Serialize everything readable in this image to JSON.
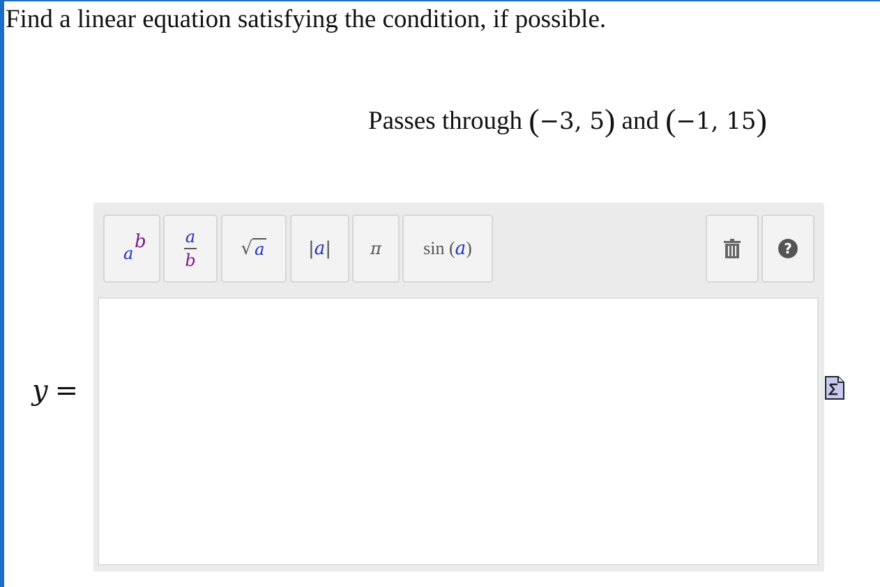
{
  "question": {
    "prompt": "Find a linear equation satisfying the condition, if possible.",
    "condition_text": "Passes through",
    "point1": {
      "x": "−3",
      "y": "5"
    },
    "connector": "and",
    "point2": {
      "x": "−1",
      "y": "15"
    }
  },
  "answer": {
    "variable": "y",
    "equals": "=",
    "value": ""
  },
  "toolbar": {
    "power": {
      "base": "a",
      "exponent": "b",
      "icon": "superscript-icon"
    },
    "fraction": {
      "numerator": "a",
      "denominator": "b",
      "icon": "fraction-icon"
    },
    "sqrt": {
      "radical": "√",
      "argument": "a",
      "icon": "square-root-icon"
    },
    "abs": {
      "bar": "|",
      "argument": "a",
      "icon": "absolute-value-icon"
    },
    "pi": {
      "symbol": "π",
      "icon": "pi-icon"
    },
    "sin": {
      "func": "sin",
      "open": "(",
      "argument": "a",
      "close": ")",
      "icon": "sine-icon"
    },
    "trash": {
      "icon": "trash-icon"
    },
    "help": {
      "symbol": "?",
      "icon": "help-icon"
    }
  },
  "colors": {
    "frame": "#1a6ec9",
    "toolbar_bg": "#ebebeb",
    "button_bg": "#f3f3f3",
    "purple_var": "#7a1a8c",
    "blue_var": "#1f2fc4",
    "icon_grey": "#555555"
  },
  "side_icon": "math-editor-icon"
}
